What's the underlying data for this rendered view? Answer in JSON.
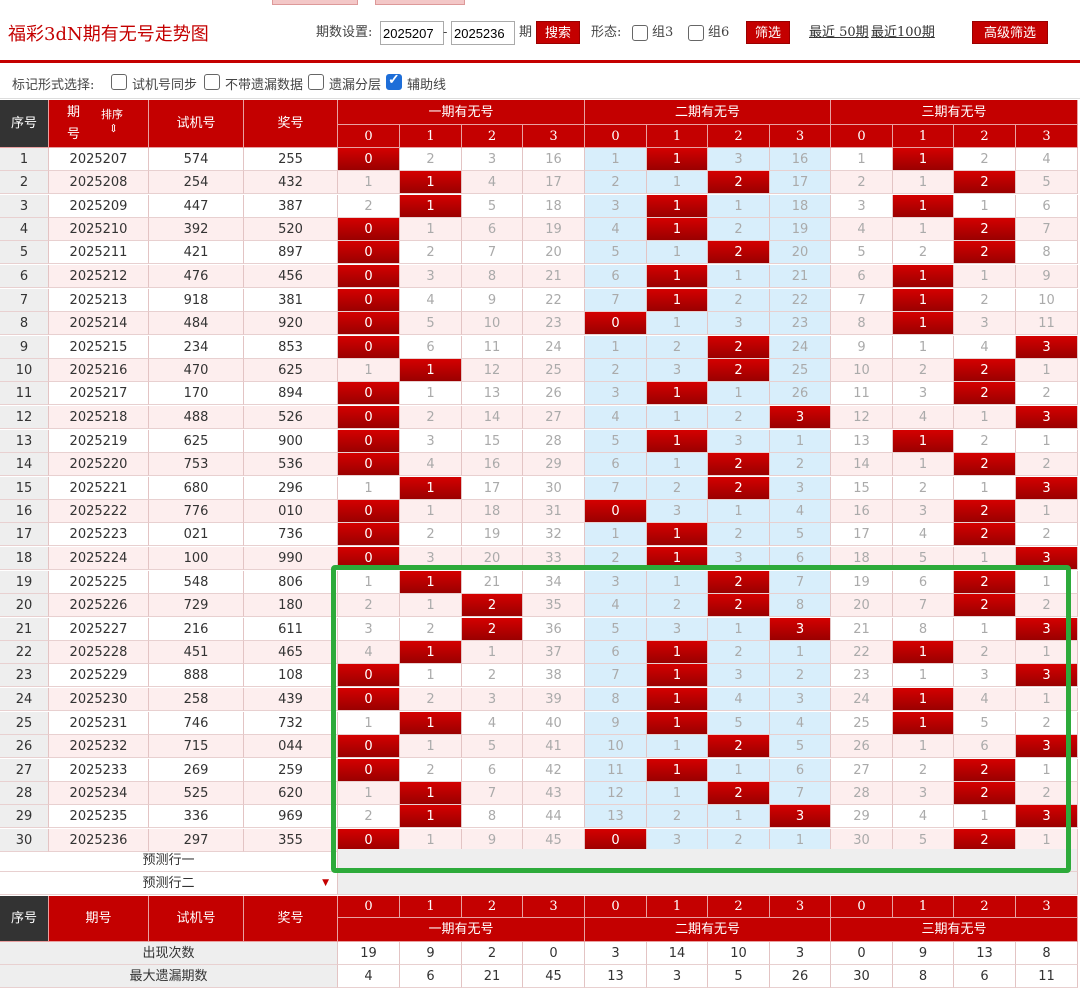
{
  "header": {
    "title": "福彩3dN期有无号走势图",
    "period_label": "期数设置:",
    "period_from": "2025207",
    "period_dash": "-",
    "period_to": "2025236",
    "period_suffix": "期",
    "search_label": "搜索",
    "form_label": "形态:",
    "group3_label": "组3",
    "group6_label": "组6",
    "filter_label": "筛选",
    "recent50_label": "最近 50期",
    "recent100_label": "最近100期",
    "advanced_filter_label": "高级筛选"
  },
  "options": {
    "label": "标记形式选择:",
    "items": [
      {
        "label": "试机号同步",
        "checked": false
      },
      {
        "label": "不带遗漏数据",
        "checked": false
      },
      {
        "label": "遗漏分层",
        "checked": false
      },
      {
        "label": "辅助线",
        "checked": true
      }
    ]
  },
  "table": {
    "col_index": "序号",
    "col_period": "期号",
    "col_period_top": "期",
    "col_period_bottom": "号",
    "sort_label": "排序",
    "col_test": "试机号",
    "col_award": "奖号",
    "group_names": [
      "一期有无号",
      "二期有无号",
      "三期有无号"
    ],
    "sub_headers": [
      "0",
      "1",
      "2",
      "3"
    ],
    "rows": [
      {
        "i": "1",
        "p": "2025207",
        "t": "574",
        "a": "255",
        "v": [
          0,
          2,
          3,
          16,
          1,
          1,
          3,
          16,
          1,
          1,
          2,
          4
        ],
        "h": [
          0,
          5,
          9
        ]
      },
      {
        "i": "2",
        "p": "2025208",
        "t": "254",
        "a": "432",
        "v": [
          1,
          1,
          4,
          17,
          2,
          1,
          2,
          17,
          2,
          1,
          2,
          5
        ],
        "h": [
          1,
          6,
          10
        ]
      },
      {
        "i": "3",
        "p": "2025209",
        "t": "447",
        "a": "387",
        "v": [
          2,
          1,
          5,
          18,
          3,
          1,
          1,
          18,
          3,
          1,
          1,
          6
        ],
        "h": [
          1,
          5,
          9
        ]
      },
      {
        "i": "4",
        "p": "2025210",
        "t": "392",
        "a": "520",
        "v": [
          0,
          1,
          6,
          19,
          4,
          1,
          2,
          19,
          4,
          1,
          2,
          7
        ],
        "h": [
          0,
          5,
          10
        ]
      },
      {
        "i": "5",
        "p": "2025211",
        "t": "421",
        "a": "897",
        "v": [
          0,
          2,
          7,
          20,
          5,
          1,
          2,
          20,
          5,
          2,
          2,
          8
        ],
        "h": [
          0,
          6,
          10
        ]
      },
      {
        "i": "6",
        "p": "2025212",
        "t": "476",
        "a": "456",
        "v": [
          0,
          3,
          8,
          21,
          6,
          1,
          1,
          21,
          6,
          1,
          1,
          9
        ],
        "h": [
          0,
          5,
          9
        ]
      },
      {
        "i": "7",
        "p": "2025213",
        "t": "918",
        "a": "381",
        "v": [
          0,
          4,
          9,
          22,
          7,
          1,
          2,
          22,
          7,
          1,
          2,
          10
        ],
        "h": [
          0,
          5,
          9
        ]
      },
      {
        "i": "8",
        "p": "2025214",
        "t": "484",
        "a": "920",
        "v": [
          0,
          5,
          10,
          23,
          0,
          1,
          3,
          23,
          8,
          1,
          3,
          11
        ],
        "h": [
          0,
          4,
          9
        ]
      },
      {
        "i": "9",
        "p": "2025215",
        "t": "234",
        "a": "853",
        "v": [
          0,
          6,
          11,
          24,
          1,
          2,
          2,
          24,
          9,
          1,
          4,
          3
        ],
        "h": [
          0,
          6,
          11
        ]
      },
      {
        "i": "10",
        "p": "2025216",
        "t": "470",
        "a": "625",
        "v": [
          1,
          1,
          12,
          25,
          2,
          3,
          2,
          25,
          10,
          2,
          2,
          1
        ],
        "h": [
          1,
          6,
          10
        ]
      },
      {
        "i": "11",
        "p": "2025217",
        "t": "170",
        "a": "894",
        "v": [
          0,
          1,
          13,
          26,
          3,
          1,
          1,
          26,
          11,
          3,
          2,
          2
        ],
        "h": [
          0,
          5,
          10
        ]
      },
      {
        "i": "12",
        "p": "2025218",
        "t": "488",
        "a": "526",
        "v": [
          0,
          2,
          14,
          27,
          4,
          1,
          2,
          3,
          12,
          4,
          1,
          3
        ],
        "h": [
          0,
          7,
          11
        ]
      },
      {
        "i": "13",
        "p": "2025219",
        "t": "625",
        "a": "900",
        "v": [
          0,
          3,
          15,
          28,
          5,
          1,
          3,
          1,
          13,
          1,
          2,
          1
        ],
        "h": [
          0,
          5,
          9
        ]
      },
      {
        "i": "14",
        "p": "2025220",
        "t": "753",
        "a": "536",
        "v": [
          0,
          4,
          16,
          29,
          6,
          1,
          2,
          2,
          14,
          1,
          2,
          2
        ],
        "h": [
          0,
          6,
          10
        ]
      },
      {
        "i": "15",
        "p": "2025221",
        "t": "680",
        "a": "296",
        "v": [
          1,
          1,
          17,
          30,
          7,
          2,
          2,
          3,
          15,
          2,
          1,
          3
        ],
        "h": [
          1,
          6,
          11
        ]
      },
      {
        "i": "16",
        "p": "2025222",
        "t": "776",
        "a": "010",
        "v": [
          0,
          1,
          18,
          31,
          0,
          3,
          1,
          4,
          16,
          3,
          2,
          1
        ],
        "h": [
          0,
          4,
          10
        ]
      },
      {
        "i": "17",
        "p": "2025223",
        "t": "021",
        "a": "736",
        "v": [
          0,
          2,
          19,
          32,
          1,
          1,
          2,
          5,
          17,
          4,
          2,
          2
        ],
        "h": [
          0,
          5,
          10
        ]
      },
      {
        "i": "18",
        "p": "2025224",
        "t": "100",
        "a": "990",
        "v": [
          0,
          3,
          20,
          33,
          2,
          1,
          3,
          6,
          18,
          5,
          1,
          3
        ],
        "h": [
          0,
          5,
          11
        ]
      },
      {
        "i": "19",
        "p": "2025225",
        "t": "548",
        "a": "806",
        "v": [
          1,
          1,
          21,
          34,
          3,
          1,
          2,
          7,
          19,
          6,
          2,
          1
        ],
        "h": [
          1,
          6,
          10
        ]
      },
      {
        "i": "20",
        "p": "2025226",
        "t": "729",
        "a": "180",
        "v": [
          2,
          1,
          2,
          35,
          4,
          2,
          2,
          8,
          20,
          7,
          2,
          2
        ],
        "h": [
          2,
          6,
          10
        ]
      },
      {
        "i": "21",
        "p": "2025227",
        "t": "216",
        "a": "611",
        "v": [
          3,
          2,
          2,
          36,
          5,
          3,
          1,
          3,
          21,
          8,
          1,
          3
        ],
        "h": [
          2,
          7,
          11
        ]
      },
      {
        "i": "22",
        "p": "2025228",
        "t": "451",
        "a": "465",
        "v": [
          4,
          1,
          1,
          37,
          6,
          1,
          2,
          1,
          22,
          1,
          2,
          1
        ],
        "h": [
          1,
          5,
          9
        ]
      },
      {
        "i": "23",
        "p": "2025229",
        "t": "888",
        "a": "108",
        "v": [
          0,
          1,
          2,
          38,
          7,
          1,
          3,
          2,
          23,
          1,
          3,
          3
        ],
        "h": [
          0,
          5,
          11
        ]
      },
      {
        "i": "24",
        "p": "2025230",
        "t": "258",
        "a": "439",
        "v": [
          0,
          2,
          3,
          39,
          8,
          1,
          4,
          3,
          24,
          1,
          4,
          1
        ],
        "h": [
          0,
          5,
          9
        ]
      },
      {
        "i": "25",
        "p": "2025231",
        "t": "746",
        "a": "732",
        "v": [
          1,
          1,
          4,
          40,
          9,
          1,
          5,
          4,
          25,
          1,
          5,
          2
        ],
        "h": [
          1,
          5,
          9
        ]
      },
      {
        "i": "26",
        "p": "2025232",
        "t": "715",
        "a": "044",
        "v": [
          0,
          1,
          5,
          41,
          10,
          1,
          2,
          5,
          26,
          1,
          6,
          3
        ],
        "h": [
          0,
          6,
          11
        ]
      },
      {
        "i": "27",
        "p": "2025233",
        "t": "269",
        "a": "259",
        "v": [
          0,
          2,
          6,
          42,
          11,
          1,
          1,
          6,
          27,
          2,
          2,
          1
        ],
        "h": [
          0,
          5,
          10
        ]
      },
      {
        "i": "28",
        "p": "2025234",
        "t": "525",
        "a": "620",
        "v": [
          1,
          1,
          7,
          43,
          12,
          1,
          2,
          7,
          28,
          3,
          2,
          2
        ],
        "h": [
          1,
          6,
          10
        ]
      },
      {
        "i": "29",
        "p": "2025235",
        "t": "336",
        "a": "969",
        "v": [
          2,
          1,
          8,
          44,
          13,
          2,
          1,
          3,
          29,
          4,
          1,
          3
        ],
        "h": [
          1,
          7,
          11
        ]
      },
      {
        "i": "30",
        "p": "2025236",
        "t": "297",
        "a": "355",
        "v": [
          0,
          1,
          9,
          45,
          0,
          3,
          2,
          1,
          30,
          5,
          2,
          1
        ],
        "h": [
          0,
          4,
          10
        ]
      }
    ],
    "predict1": "预测行一",
    "predict2": "预测行二",
    "stats": [
      {
        "label": "出现次数",
        "v": [
          "19",
          "9",
          "2",
          "0",
          "3",
          "14",
          "10",
          "3",
          "0",
          "9",
          "13",
          "8"
        ]
      },
      {
        "label": "最大遗漏期数",
        "v": [
          "4",
          "6",
          "21",
          "45",
          "13",
          "3",
          "5",
          "26",
          "30",
          "8",
          "6",
          "11"
        ]
      }
    ]
  }
}
